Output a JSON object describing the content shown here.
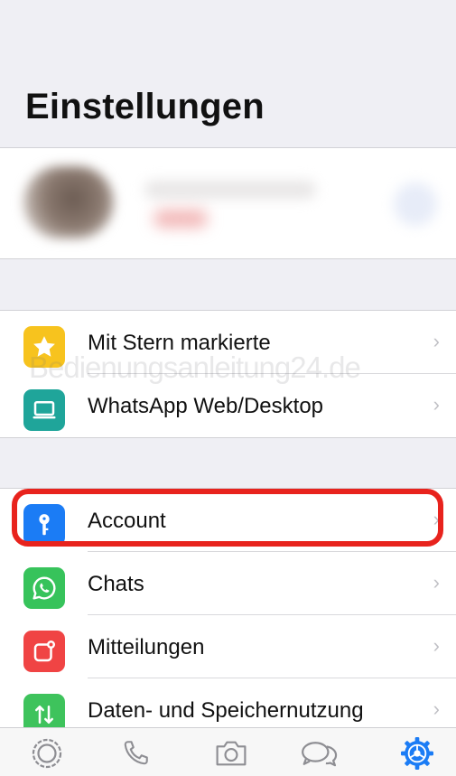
{
  "header": {
    "title": "Einstellungen"
  },
  "watermark": "Bedienungsanleitung24.de",
  "sections": [
    {
      "items": [
        {
          "label": "Mit Stern markierte",
          "icon": "star-icon",
          "color": "#f7c31e"
        },
        {
          "label": "WhatsApp Web/Desktop",
          "icon": "laptop-icon",
          "color": "#1fa59a"
        }
      ]
    },
    {
      "items": [
        {
          "label": "Account",
          "icon": "key-icon",
          "color": "#1b7cf5",
          "highlighted": true
        },
        {
          "label": "Chats",
          "icon": "whatsapp-icon",
          "color": "#37c35b"
        },
        {
          "label": "Mitteilungen",
          "icon": "notification-icon",
          "color": "#f04444"
        },
        {
          "label": "Daten- und Speichernutzung",
          "icon": "data-arrows-icon",
          "color": "#3ec35c"
        }
      ]
    }
  ],
  "tabbar": {
    "tabs": [
      {
        "icon": "status-icon"
      },
      {
        "icon": "phone-icon"
      },
      {
        "icon": "camera-icon"
      },
      {
        "icon": "chats-icon"
      },
      {
        "icon": "settings-gear-icon",
        "active": true,
        "color": "#1b7cf5"
      }
    ]
  },
  "colors": {
    "highlight": "#e8231d",
    "background": "#efeff4",
    "chevron": "#c1c1c6"
  }
}
